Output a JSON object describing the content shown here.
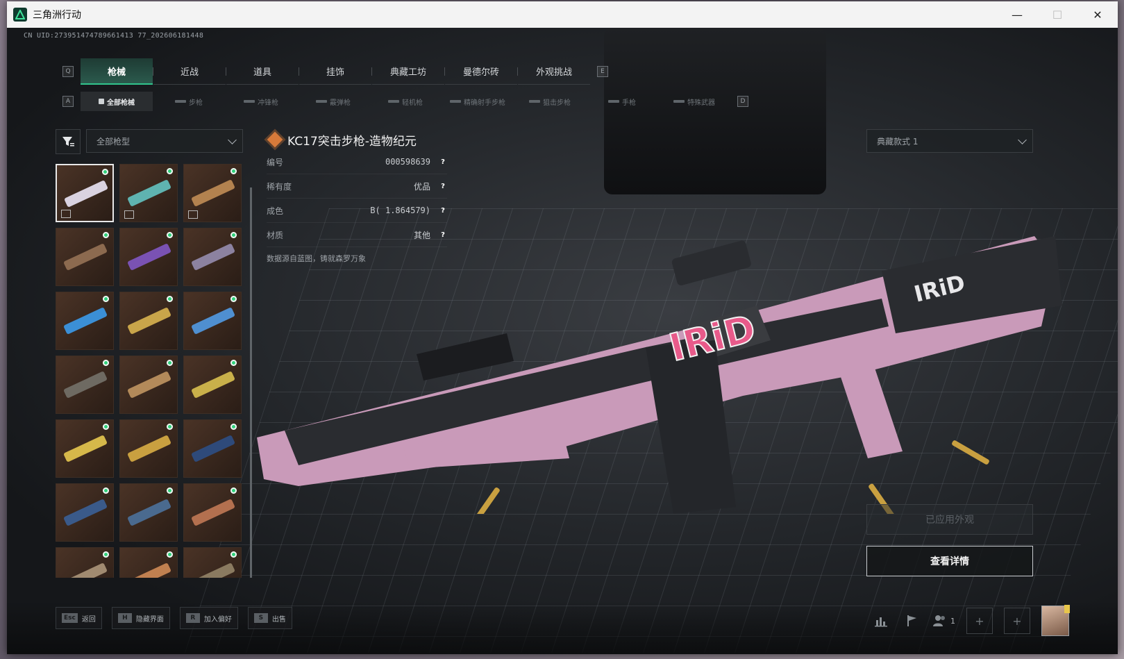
{
  "window": {
    "title": "三角洲行动",
    "minimize": "—",
    "maximize": "☐",
    "close": "✕"
  },
  "uid": "CN UID:273951474789661413 77_202606181448",
  "main_tabs": {
    "prev_key": "Q",
    "next_key": "E",
    "items": [
      {
        "label": "枪械",
        "active": true
      },
      {
        "label": "近战"
      },
      {
        "label": "道具"
      },
      {
        "label": "挂饰"
      },
      {
        "label": "典藏工坊"
      },
      {
        "label": "曼德尔砖"
      },
      {
        "label": "外观挑战"
      }
    ]
  },
  "sub_tabs": {
    "prev_key": "A",
    "next_key": "D",
    "items": [
      {
        "label": "全部枪械",
        "active": true
      },
      {
        "label": "步枪"
      },
      {
        "label": "冲锋枪"
      },
      {
        "label": "霰弹枪"
      },
      {
        "label": "轻机枪"
      },
      {
        "label": "精确射手步枪"
      },
      {
        "label": "狙击步枪"
      },
      {
        "label": "手枪"
      },
      {
        "label": "特殊武器"
      }
    ]
  },
  "filter": {
    "selected": "全部枪型"
  },
  "skins": [
    {
      "tone": "#d9d2e0",
      "selected": true,
      "badge": true
    },
    {
      "tone": "#5fb3b0",
      "badge": true
    },
    {
      "tone": "#b3824f",
      "badge": true
    },
    {
      "tone": "#8c6a4f"
    },
    {
      "tone": "#7a52b3"
    },
    {
      "tone": "#8c82a0"
    },
    {
      "tone": "#3b8fd6"
    },
    {
      "tone": "#c9a54a"
    },
    {
      "tone": "#4f8fd0"
    },
    {
      "tone": "#6e6a62"
    },
    {
      "tone": "#b38a5a"
    },
    {
      "tone": "#c9b04a"
    },
    {
      "tone": "#d6b84a"
    },
    {
      "tone": "#c9a040"
    },
    {
      "tone": "#2e4a7a"
    },
    {
      "tone": "#3a5a8a"
    },
    {
      "tone": "#4a6a8f"
    },
    {
      "tone": "#b3704f"
    },
    {
      "tone": "#a08a70"
    },
    {
      "tone": "#c08050"
    },
    {
      "tone": "#8a7a60"
    }
  ],
  "weapon": {
    "name": "KC17突击步枪-造物纪元",
    "attributes": [
      {
        "label": "编号",
        "value": "000598639"
      },
      {
        "label": "稀有度",
        "value": "优品"
      },
      {
        "label": "成色",
        "value": "B( 1.864579)"
      },
      {
        "label": "材质",
        "value": "其他"
      }
    ],
    "help": "?",
    "source": "数据源自蓝图，铸就森罗万象",
    "decal": "IRiD"
  },
  "style_select": {
    "selected": "典藏款式 1"
  },
  "buttons": {
    "applied": "已应用外观",
    "details": "查看详情"
  },
  "hotkeys": [
    {
      "key": "Esc",
      "label": "返回"
    },
    {
      "key": "H",
      "label": "隐藏界面"
    },
    {
      "key": "R",
      "label": "加入偏好"
    },
    {
      "key": "S",
      "label": "出售"
    }
  ],
  "tray": {
    "party_count": "1",
    "plus": "+"
  },
  "colors": {
    "accent": "#31c48d",
    "weapon_pink": "#d9a8c9",
    "rarity": "#d87a3a"
  }
}
